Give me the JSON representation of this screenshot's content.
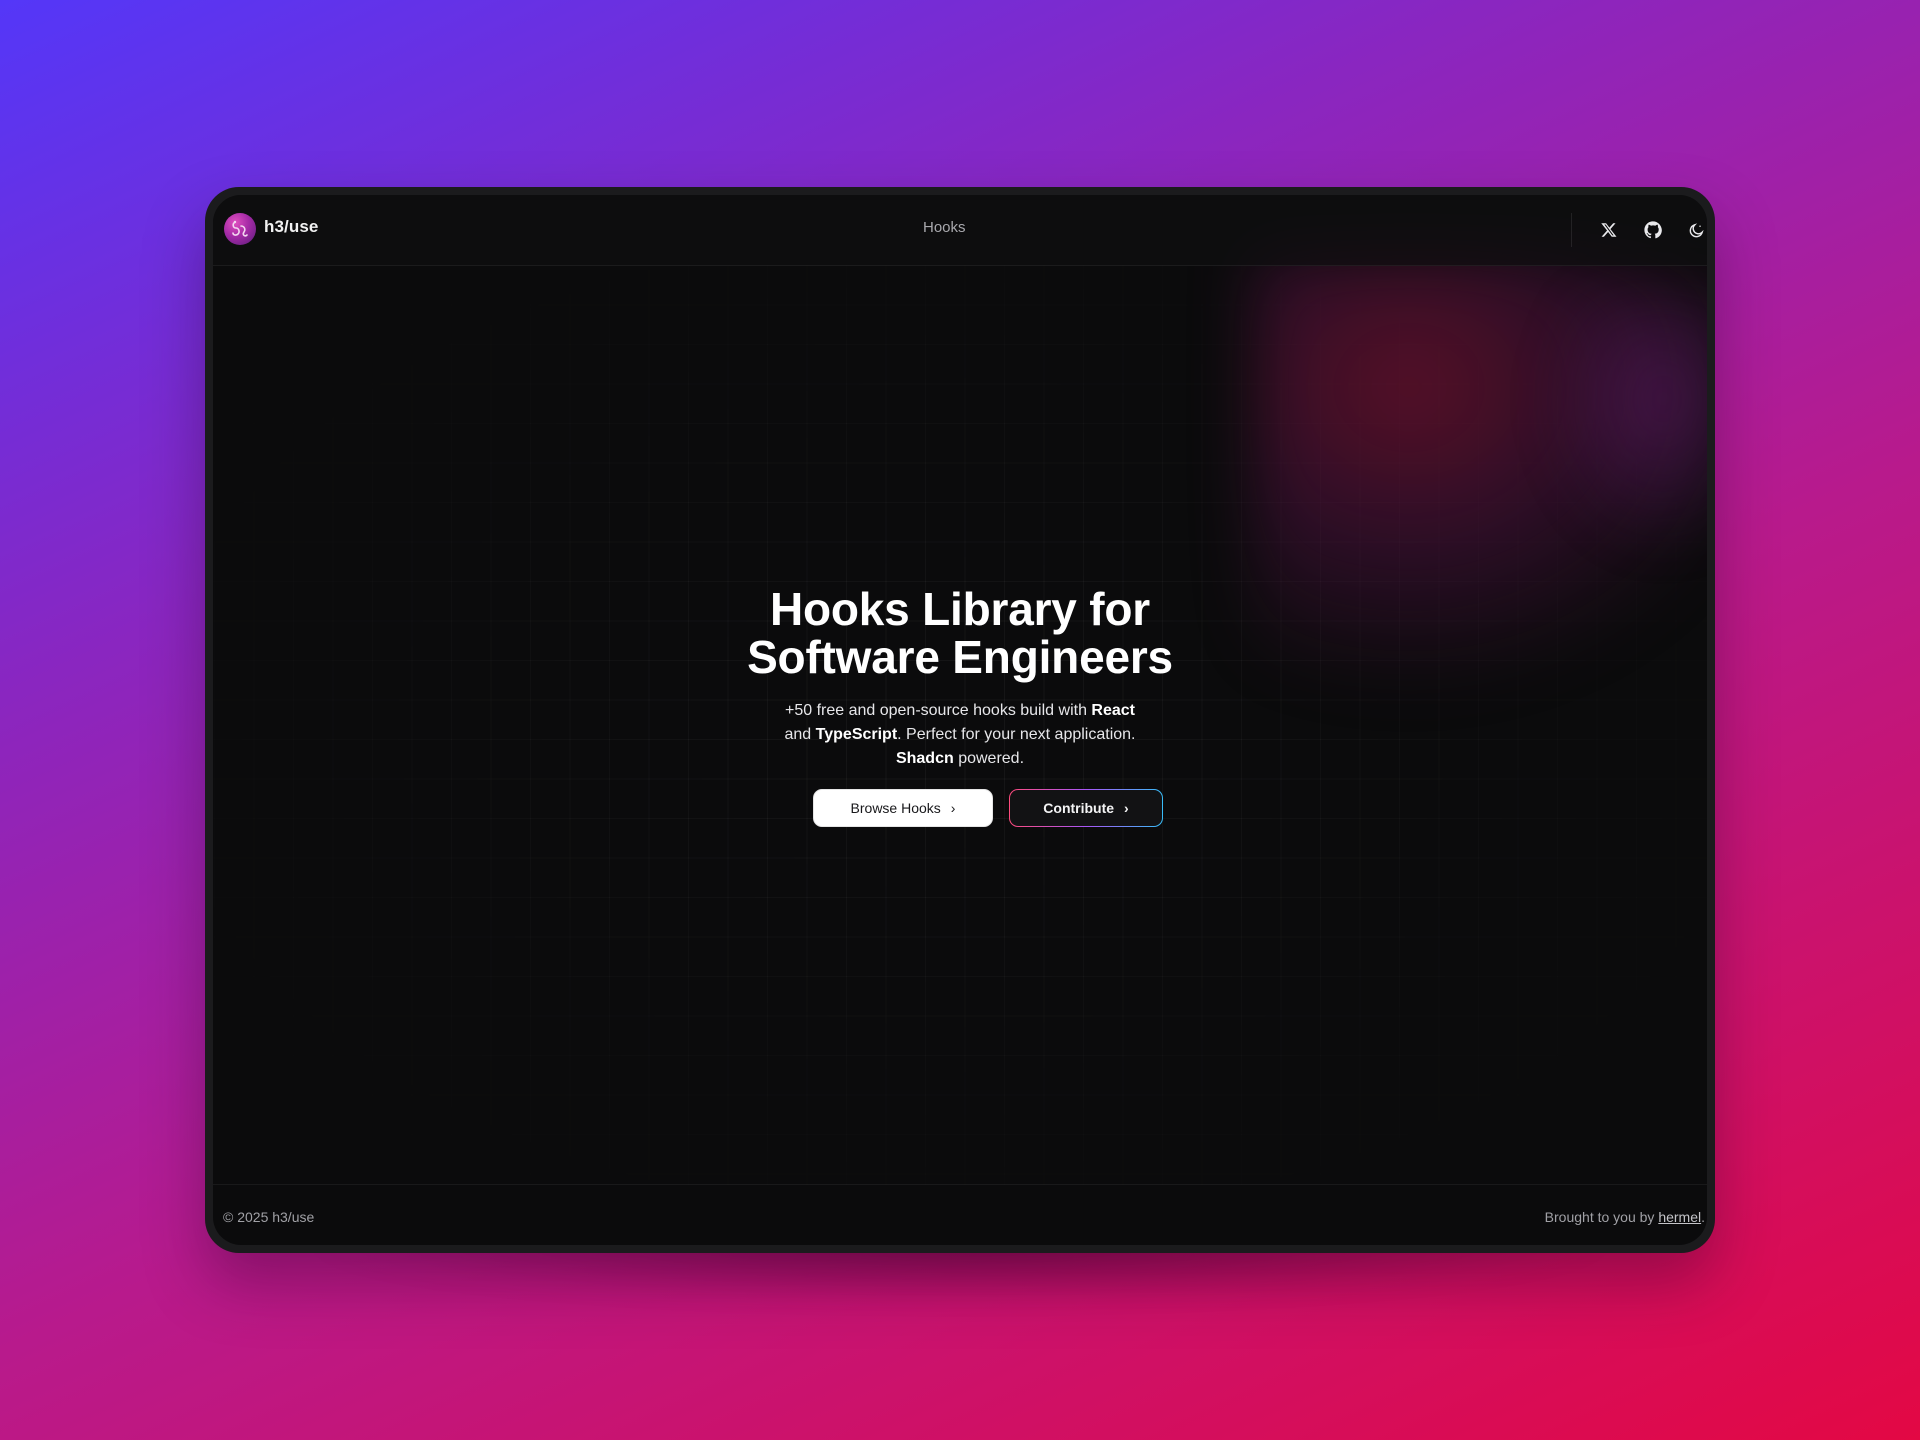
{
  "brand": {
    "name": "h3/use",
    "logo_icon": "hook-logo-icon"
  },
  "nav": {
    "hooks_label": "Hooks"
  },
  "header_icons": {
    "x": "x-icon",
    "github": "github-icon",
    "theme": "theme-toggle-icon"
  },
  "hero": {
    "title_line1": "Hooks Library for",
    "title_line2": "Software Engineers",
    "desc_part1": "+50 free and open-source hooks build with",
    "desc_react": "React",
    "desc_and": "and",
    "desc_typescript": "TypeScript",
    "desc_part2": ". Perfect for your next application.",
    "desc_shadcn": "Shadcn",
    "desc_part3": "powered."
  },
  "buttons": {
    "browse_label": "Browse Hooks",
    "contribute_label": "Contribute",
    "chevron": "›"
  },
  "footer": {
    "copyright": "© 2025 h3/use",
    "credit_prefix": "Brought to you by",
    "credit_link": "hermel",
    "credit_suffix": "."
  },
  "colors": {
    "background_start": "#5437f8",
    "background_end": "#e30844",
    "surface": "#0b0b0c",
    "accent_glow": "#96143c"
  }
}
